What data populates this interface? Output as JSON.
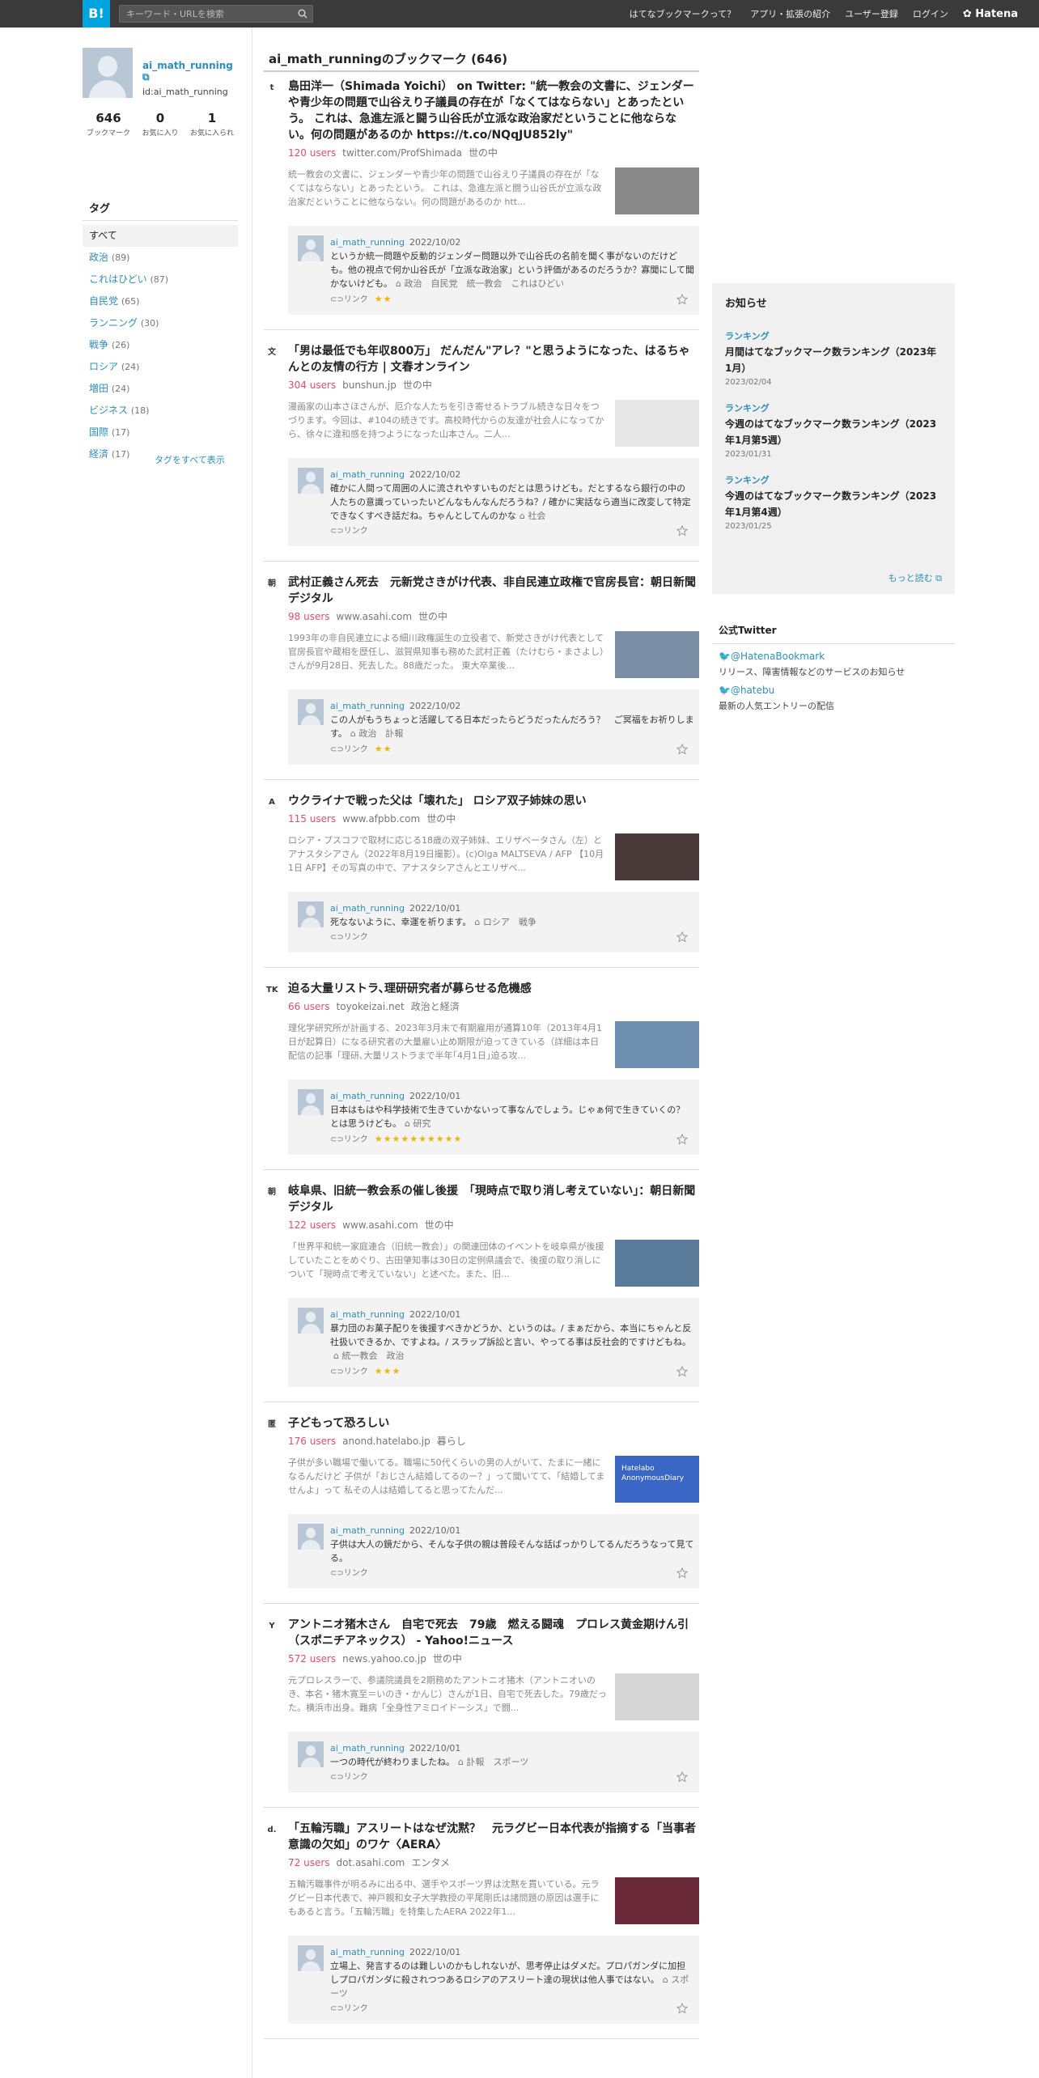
{
  "header": {
    "logo": "B!",
    "search_placeholder": "キーワード・URLを検索",
    "nav": [
      "はてなブックマークって？",
      "アプリ・拡張の紹介",
      "ユーザー登録",
      "ログイン"
    ],
    "brand": "Hatena"
  },
  "profile": {
    "name": "ai_math_running",
    "id": "id:ai_math_running",
    "stats": [
      {
        "num": "646",
        "label": "ブックマーク"
      },
      {
        "num": "0",
        "label": "お気に入り"
      },
      {
        "num": "1",
        "label": "お気に入られ"
      }
    ]
  },
  "tags": {
    "heading": "タグ",
    "all": "すべて",
    "items": [
      {
        "name": "政治",
        "count": "(89)"
      },
      {
        "name": "これはひどい",
        "count": "(87)"
      },
      {
        "name": "自民党",
        "count": "(65)"
      },
      {
        "name": "ランニング",
        "count": "(30)"
      },
      {
        "name": "戦争",
        "count": "(26)"
      },
      {
        "name": "ロシア",
        "count": "(24)"
      },
      {
        "name": "増田",
        "count": "(24)"
      },
      {
        "name": "ビジネス",
        "count": "(18)"
      },
      {
        "name": "国際",
        "count": "(17)"
      },
      {
        "name": "経済",
        "count": "(17)"
      }
    ],
    "show_all": "タグをすべて表示"
  },
  "main": {
    "title": "ai_math_runningのブックマーク (646)",
    "link_label": "リンク",
    "entries": [
      {
        "fav": "t",
        "title": "島田洋一（Shimada Yoichi） on Twitter: \"統一教会の文書に、ジェンダーや青少年の問題で山谷えり子議員の存在が「なくてはならない」とあったという。 これは、急進左派と闘う山谷氏が立派な政治家だということに他ならない。何の問題があるのか https://t.co/NQqJU852ly\"",
        "users": "120 users",
        "domain": "twitter.com/ProfShimada",
        "category": "世の中",
        "desc": "統一教会の文書に、ジェンダーや青少年の問題で山谷えり子議員の存在が「なくてはならない」とあったという。 これは、急進左派と闘う山谷氏が立派な政治家だということに他ならない。何の問題があるのか htt...",
        "user": "ai_math_running",
        "date": "2022/10/02",
        "comment": "というか統一問題や反動的ジェンダー問題以外で山谷氏の名前を聞く事がないのだけども。他の視点で何か山谷氏が「立派な政治家」という評価があるのだろうか？寡聞にして聞かないけども。",
        "tags": "政治　自民党　統一教会　これはひどい",
        "stars": "★★"
      },
      {
        "fav": "文",
        "title": "「男は最低でも年収800万」 だんだん\"アレ？\"と思うようになった、はるちゃんとの友情の行方 | 文春オンライン",
        "users": "304 users",
        "domain": "bunshun.jp",
        "category": "世の中",
        "desc": "漫画家の山本さほさんが、厄介な人たちを引き寄せるトラブル続きな日々をつづります。今回は、#104の続きです。高校時代からの友達が社会人になってから、徐々に違和感を持つようになった山本さん。二人...",
        "user": "ai_math_running",
        "date": "2022/10/02",
        "comment": "確かに人間って周囲の人に流されやすいものだとは思うけども。だとするなら銀行の中の人たちの意識っていったいどんなもんなんだろうね？/ 確かに実話なら適当に改変して特定できなくすべき話だね。ちゃんとしてんのかな",
        "tags": "社会",
        "stars": ""
      },
      {
        "fav": "朝",
        "title": "武村正義さん死去　元新党さきがけ代表、非自民連立政権で官房長官：朝日新聞デジタル",
        "users": "98 users",
        "domain": "www.asahi.com",
        "category": "世の中",
        "desc": "1993年の非自民連立による細川政権誕生の立役者で、新党さきがけ代表として官房長官や蔵相を歴任し、滋賀県知事も務めた武村正義（たけむら・まさよし）さんが9月28日、死去した。88歳だった。 東大卒業後...",
        "user": "ai_math_running",
        "date": "2022/10/02",
        "comment": "この人がもうちょっと活躍してる日本だったらどうだったんだろう？　ご冥福をお祈りします。",
        "tags": "政治　訃報",
        "stars": "★★"
      },
      {
        "fav": "A",
        "title": "ウクライナで戦った父は「壊れた」 ロシア双子姉妹の思い",
        "users": "115 users",
        "domain": "www.afpbb.com",
        "category": "世の中",
        "desc": "ロシア・プスコフで取材に応じる18歳の双子姉妹、エリザベータさん（左）とアナスタシアさん（2022年8月19日撮影）。(c)Olga MALTSEVA / AFP 【10月1日 AFP】その写真の中で、アナスタシアさんとエリザベ...",
        "user": "ai_math_running",
        "date": "2022/10/01",
        "comment": "死なないように、幸運を祈ります。",
        "tags": "ロシア　戦争",
        "stars": ""
      },
      {
        "fav": "TK",
        "title": "迫る大量リストラ､理研研究者が募らせる危機感",
        "users": "66 users",
        "domain": "toyokeizai.net",
        "category": "政治と経済",
        "desc": "理化学研究所が計画する、2023年3月末で有期雇用が通算10年（2013年4月1日が起算日）になる研究者の大量雇い止め期限が迫ってきている（詳細は本日配信の記事「理研､大量リストラまで半年｢4月1日｣迫る攻...",
        "user": "ai_math_running",
        "date": "2022/10/01",
        "comment": "日本はもはや科学技術で生きていかないって事なんでしょう。じゃぁ何で生きていくの？　とは思うけども。",
        "tags": "研究",
        "stars": "★★★★★★★★★★"
      },
      {
        "fav": "朝",
        "title": "岐阜県、旧統一教会系の催し後援　「現時点で取り消し考えていない」：朝日新聞デジタル",
        "users": "122 users",
        "domain": "www.asahi.com",
        "category": "世の中",
        "desc": "「世界平和統一家庭連合（旧統一教会）」の関連団体のイベントを岐阜県が後援していたことをめぐり、古田肇知事は30日の定例県議会で、後援の取り消しについて「現時点で考えていない」と述べた。また、旧...",
        "user": "ai_math_running",
        "date": "2022/10/01",
        "comment": "暴力団のお菓子配りを後援すべきかどうか、というのは。/ まぁだから、本当にちゃんと反社扱いできるか、ですよね。/ スラップ訴訟と言い、やってる事は反社会的ですけどもね。",
        "tags": "統一教会　政治",
        "stars": "★★★"
      },
      {
        "fav": "匿",
        "title": "子どもって恐ろしい",
        "users": "176 users",
        "domain": "anond.hatelabo.jp",
        "category": "暮らし",
        "desc": "子供が多い職場で働いてる。職場に50代くらいの男の人がいて、たまに一緒になるんだけど 子供が「おじさん結婚してるのー？」って聞いてて、「結婚してませんよ」って 私その人は結婚してると思ってたんだ...",
        "user": "ai_math_running",
        "date": "2022/10/01",
        "comment": "子供は大人の鏡だから、そんな子供の親は普段そんな話ばっかりしてるんだろうなって見てる。",
        "tags": "",
        "stars": "",
        "thumb_text": "Hatelabo AnonymousDiary"
      },
      {
        "fav": "Y",
        "title": "アントニオ猪木さん　自宅で死去　79歳　燃える闘魂　プロレス黄金期けん引（スポニチアネックス） - Yahoo!ニュース",
        "users": "572 users",
        "domain": "news.yahoo.co.jp",
        "category": "世の中",
        "desc": "元プロレスラーで、参議院議員を2期務めたアントニオ猪木（アントニオいのき、本名・猪木寛至＝いのき・かんじ）さんが1日、自宅で死去した。79歳だった。横浜市出身。難病「全身性アミロイドーシス」で闘...",
        "user": "ai_math_running",
        "date": "2022/10/01",
        "comment": "一つの時代が終わりましたね。",
        "tags": "訃報　スポーツ",
        "stars": ""
      },
      {
        "fav": "d.",
        "title": "「五輪汚職」アスリートはなぜ沈黙？　元ラグビー日本代表が指摘する「当事者意識の欠如」のワケ〈AERA〉",
        "users": "72 users",
        "domain": "dot.asahi.com",
        "category": "エンタメ",
        "desc": "五輪汚職事件が明るみに出る中、選手やスポーツ界は沈黙を貫いている。元ラグビー日本代表で、神戸親和女子大学教授の平尾剛氏は諸問題の原因は選手にもあると言う。「五輪汚職」を特集したAERA 2022年1...",
        "user": "ai_math_running",
        "date": "2022/10/01",
        "comment": "立場上、発言するのは難しいのかもしれないが、思考停止はダメだ。プロパガンダに加担しプロパガンダに殺されつつあるロシアのアスリート達の現状は他人事ではない。",
        "tags": "スポーツ",
        "stars": ""
      }
    ]
  },
  "news": {
    "heading": "お知らせ",
    "items": [
      {
        "cat": "ランキング",
        "title": "月間はてなブックマーク数ランキング（2023年1月）",
        "date": "2023/02/04"
      },
      {
        "cat": "ランキング",
        "title": "今週のはてなブックマーク数ランキング（2023年1月第5週）",
        "date": "2023/01/31"
      },
      {
        "cat": "ランキング",
        "title": "今週のはてなブックマーク数ランキング（2023年1月第4週）",
        "date": "2023/01/25"
      }
    ],
    "more": "もっと読む"
  },
  "twitter": {
    "heading": "公式Twitter",
    "accounts": [
      {
        "handle": "@HatenaBookmark",
        "desc": "リリース、障害情報などのサービスのお知らせ"
      },
      {
        "handle": "@hatebu",
        "desc": "最新の人気エントリーの配信"
      }
    ]
  }
}
